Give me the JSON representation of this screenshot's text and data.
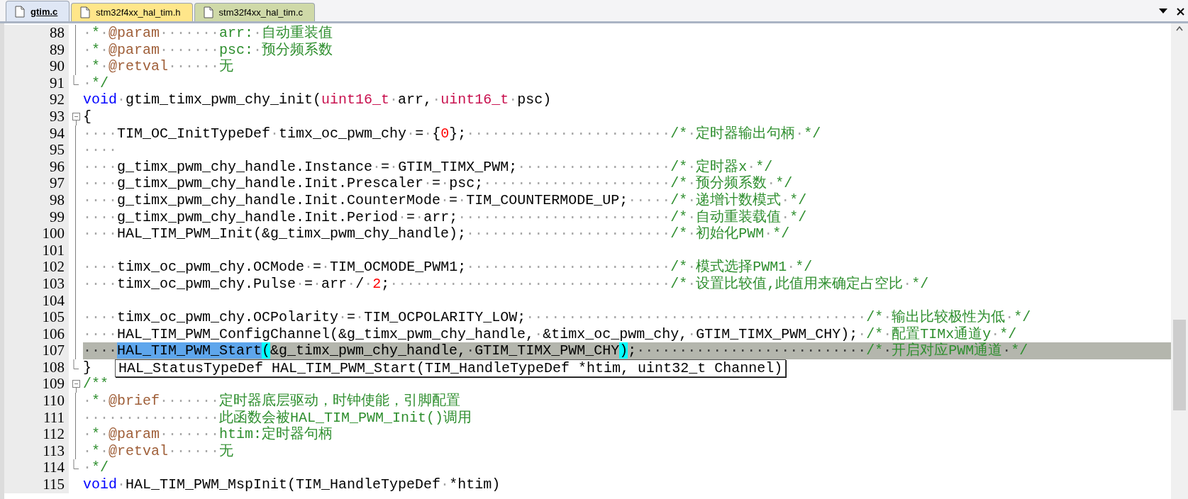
{
  "tabs": [
    {
      "label": "gtim.c",
      "selected": true,
      "color": "#dfe7f5"
    },
    {
      "label": "stm32f4xx_hal_tim.h",
      "selected": false,
      "color": "#ffe68a"
    },
    {
      "label": "stm32f4xx_hal_tim.c",
      "selected": false,
      "color": "#cfd9a8"
    }
  ],
  "lines": [
    {
      "number": "88",
      "kind": "line",
      "highlighted": false,
      "segments": [
        {
          "kind": "comment",
          "text": "·*·"
        },
        {
          "kind": "doctag",
          "text": "@param"
        },
        {
          "kind": "comment",
          "text": "·······arr:·自动重装值"
        }
      ]
    },
    {
      "number": "89",
      "kind": "line",
      "highlighted": false,
      "segments": [
        {
          "kind": "comment",
          "text": "·*·"
        },
        {
          "kind": "doctag",
          "text": "@param"
        },
        {
          "kind": "comment",
          "text": "·······psc:·预分频系数"
        }
      ]
    },
    {
      "number": "90",
      "kind": "line",
      "highlighted": false,
      "segments": [
        {
          "kind": "comment",
          "text": "·*·"
        },
        {
          "kind": "doctag",
          "text": "@retval"
        },
        {
          "kind": "comment",
          "text": "······无"
        }
      ]
    },
    {
      "number": "91",
      "kind": "end",
      "highlighted": false,
      "segments": [
        {
          "kind": "comment",
          "text": "·*/"
        }
      ]
    },
    {
      "number": "92",
      "kind": "none",
      "highlighted": false,
      "segments": [
        {
          "kind": "keyword",
          "text": "void"
        },
        {
          "kind": "plain",
          "text": "·gtim_timx_pwm_chy_init("
        },
        {
          "kind": "type",
          "text": "uint16_t"
        },
        {
          "kind": "plain",
          "text": "·arr,·"
        },
        {
          "kind": "type",
          "text": "uint16_t"
        },
        {
          "kind": "plain",
          "text": "·psc)"
        }
      ]
    },
    {
      "number": "93",
      "kind": "start",
      "highlighted": false,
      "segments": [
        {
          "kind": "plain",
          "text": "{"
        }
      ]
    },
    {
      "number": "94",
      "kind": "line",
      "highlighted": false,
      "segments": [
        {
          "kind": "plain",
          "text": "····TIM_OC_InitTypeDef·timx_oc_pwm_chy·=·{"
        },
        {
          "kind": "number",
          "text": "0"
        },
        {
          "kind": "plain",
          "text": "};························"
        },
        {
          "kind": "comment",
          "text": "/*·定时器输出句柄·*/"
        }
      ]
    },
    {
      "number": "95",
      "kind": "line",
      "highlighted": false,
      "segments": [
        {
          "kind": "plain",
          "text": "····"
        }
      ]
    },
    {
      "number": "96",
      "kind": "line",
      "highlighted": false,
      "segments": [
        {
          "kind": "plain",
          "text": "····g_timx_pwm_chy_handle.Instance·=·GTIM_TIMX_PWM;··················"
        },
        {
          "kind": "comment",
          "text": "/*·定时器x·*/"
        }
      ]
    },
    {
      "number": "97",
      "kind": "line",
      "highlighted": false,
      "segments": [
        {
          "kind": "plain",
          "text": "····g_timx_pwm_chy_handle.Init.Prescaler·=·psc;······················"
        },
        {
          "kind": "comment",
          "text": "/*·预分频系数·*/"
        }
      ]
    },
    {
      "number": "98",
      "kind": "line",
      "highlighted": false,
      "segments": [
        {
          "kind": "plain",
          "text": "····g_timx_pwm_chy_handle.Init.CounterMode·=·TIM_COUNTERMODE_UP;·····"
        },
        {
          "kind": "comment",
          "text": "/*·递增计数模式·*/"
        }
      ]
    },
    {
      "number": "99",
      "kind": "line",
      "highlighted": false,
      "segments": [
        {
          "kind": "plain",
          "text": "····g_timx_pwm_chy_handle.Init.Period·=·arr;·························"
        },
        {
          "kind": "comment",
          "text": "/*·自动重装载值·*/"
        }
      ]
    },
    {
      "number": "100",
      "kind": "line",
      "highlighted": false,
      "segments": [
        {
          "kind": "plain",
          "text": "····HAL_TIM_PWM_Init(&g_timx_pwm_chy_handle);························"
        },
        {
          "kind": "comment",
          "text": "/*·初始化PWM·*/"
        }
      ]
    },
    {
      "number": "101",
      "kind": "line"
    },
    {
      "number": "102",
      "kind": "line",
      "highlighted": false,
      "segments": [
        {
          "kind": "plain",
          "text": "····timx_oc_pwm_chy.OCMode·=·TIM_OCMODE_PWM1;························"
        },
        {
          "kind": "comment",
          "text": "/*·模式选择PWM1·*/"
        }
      ]
    },
    {
      "number": "103",
      "kind": "line",
      "highlighted": false,
      "segments": [
        {
          "kind": "plain",
          "text": "····timx_oc_pwm_chy.Pulse·=·arr·/·"
        },
        {
          "kind": "number",
          "text": "2"
        },
        {
          "kind": "plain",
          "text": ";·································"
        },
        {
          "kind": "comment",
          "text": "/*·设置比较值,此值用来确定占空比·*/"
        }
      ]
    },
    {
      "number": "104",
      "kind": "line"
    },
    {
      "number": "105",
      "kind": "line",
      "highlighted": false,
      "segments": [
        {
          "kind": "plain",
          "text": "····timx_oc_pwm_chy.OCPolarity·=·TIM_OCPOLARITY_LOW;········································"
        },
        {
          "kind": "comment",
          "text": "/*·输出比较极性为低·*/"
        }
      ]
    },
    {
      "number": "106",
      "kind": "line",
      "highlighted": false,
      "segments": [
        {
          "kind": "plain",
          "text": "····HAL_TIM_PWM_ConfigChannel(&g_timx_pwm_chy_handle,·&timx_oc_pwm_chy,·GTIM_TIMX_PWM_CHY);·"
        },
        {
          "kind": "comment",
          "text": "/*·配置TIMx通道y·*/"
        }
      ]
    },
    {
      "number": "107",
      "kind": "line",
      "highlighted": true,
      "segments": [
        {
          "kind": "plain",
          "text": "····"
        },
        {
          "kind": "selection",
          "text": "HAL_TIM_PWM_Start"
        },
        {
          "kind": "brace",
          "text": "("
        },
        {
          "kind": "plain",
          "text": "&g_timx_pwm_chy_handle,·GTIM_TIMX_PWM_CHY"
        },
        {
          "kind": "brace",
          "text": ")"
        },
        {
          "kind": "plain",
          "text": ";···························"
        },
        {
          "kind": "comment",
          "text": "/*·开启对应PWM通道·*/"
        }
      ]
    },
    {
      "number": "108",
      "kind": "end",
      "highlighted": false,
      "segments": [
        {
          "kind": "plain",
          "text": "}"
        }
      ],
      "tooltip": "HAL_StatusTypeDef HAL_TIM_PWM_Start(TIM_HandleTypeDef *htim, uint32_t Channel)"
    },
    {
      "number": "109",
      "kind": "start",
      "highlighted": false,
      "segments": [
        {
          "kind": "comment",
          "text": "/**"
        }
      ]
    },
    {
      "number": "110",
      "kind": "line",
      "highlighted": false,
      "segments": [
        {
          "kind": "comment",
          "text": "·*·"
        },
        {
          "kind": "doctag",
          "text": "@brief"
        },
        {
          "kind": "comment",
          "text": "·······定时器底层驱动，时钟使能，引脚配置"
        }
      ]
    },
    {
      "number": "111",
      "kind": "line",
      "highlighted": false,
      "segments": [
        {
          "kind": "comment",
          "text": "················此函数会被HAL_TIM_PWM_Init()调用"
        }
      ]
    },
    {
      "number": "112",
      "kind": "line",
      "highlighted": false,
      "segments": [
        {
          "kind": "comment",
          "text": "·*·"
        },
        {
          "kind": "doctag",
          "text": "@param"
        },
        {
          "kind": "comment",
          "text": "·······htim:定时器句柄"
        }
      ]
    },
    {
      "number": "113",
      "kind": "line",
      "highlighted": false,
      "segments": [
        {
          "kind": "comment",
          "text": "·*·"
        },
        {
          "kind": "doctag",
          "text": "@retval"
        },
        {
          "kind": "comment",
          "text": "······无"
        }
      ]
    },
    {
      "number": "114",
      "kind": "end",
      "highlighted": false,
      "segments": [
        {
          "kind": "comment",
          "text": "·*/"
        }
      ]
    },
    {
      "number": "115",
      "kind": "none",
      "highlighted": false,
      "segments": [
        {
          "kind": "keyword",
          "text": "void"
        },
        {
          "kind": "plain",
          "text": "·HAL_TIM_PWM_MspInit(TIM_HandleTypeDef·*htim)"
        }
      ]
    }
  ]
}
